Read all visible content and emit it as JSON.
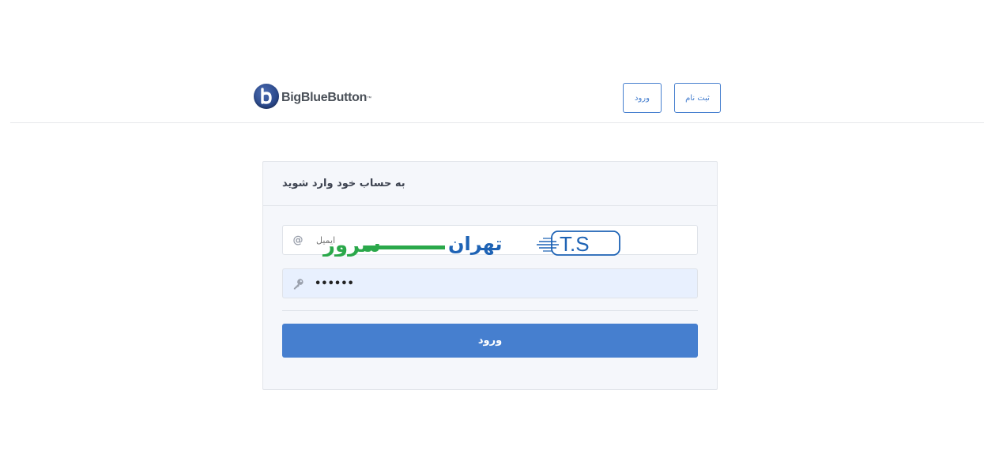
{
  "header": {
    "logo_text": "BigBlueButton",
    "logo_trademark": "™",
    "nav_login_label": "ورود",
    "nav_signup_label": "ثبت نام"
  },
  "login_card": {
    "title": "به حساب خود وارد شوید",
    "email_placeholder": "ایمیل",
    "email_icon": "at-sign-icon",
    "password_value": "••••••",
    "password_icon": "key-icon",
    "submit_label": "ورود"
  },
  "watermark": {
    "text": "تهران",
    "monogram": "T.S",
    "tail_text": "سرور"
  },
  "colors": {
    "accent": "#467fcf",
    "watermark_blue": "#1e63b5",
    "watermark_green": "#2aa84a",
    "card_bg": "#f5f7fb",
    "autofill_bg": "#e8f0fe"
  }
}
